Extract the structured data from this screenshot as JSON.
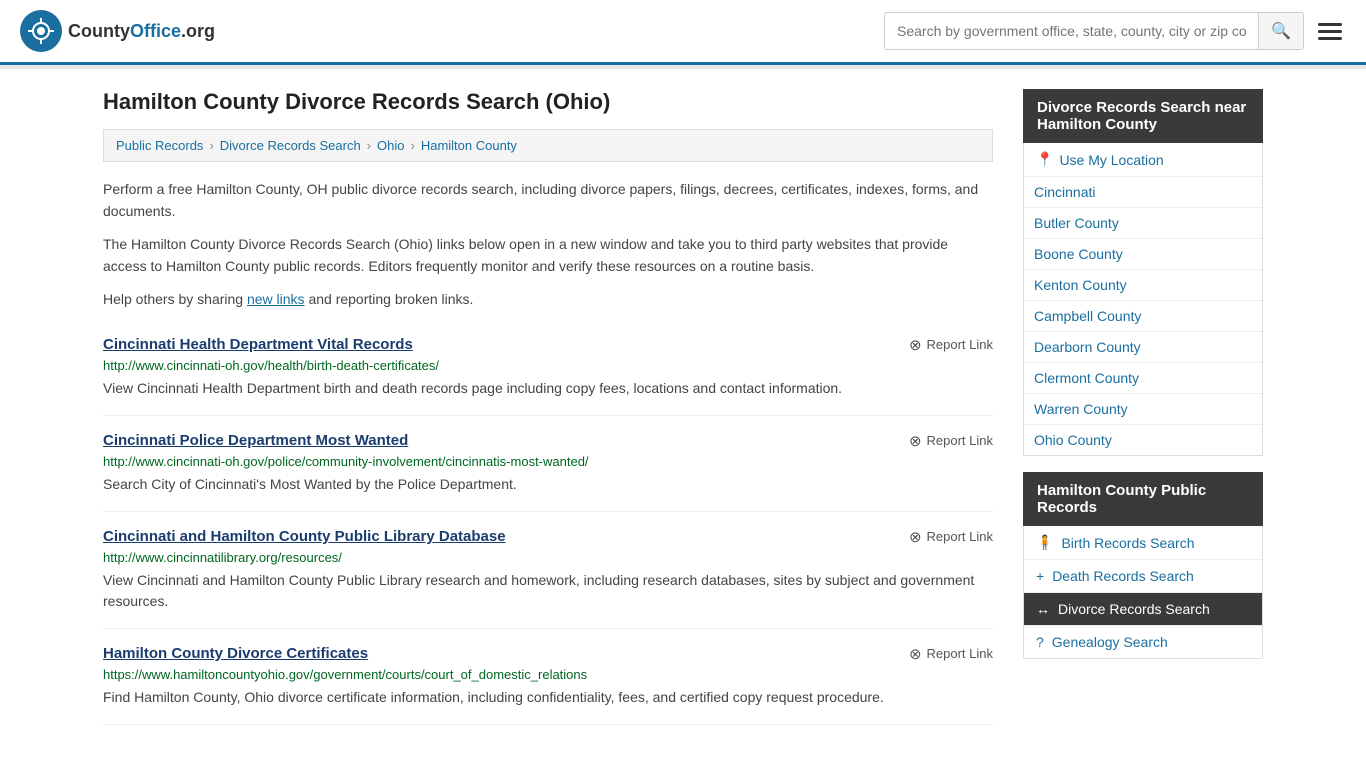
{
  "header": {
    "logo_text": "CountyOffice",
    "logo_suffix": ".org",
    "search_placeholder": "Search by government office, state, county, city or zip code",
    "search_icon": "🔍"
  },
  "page": {
    "title": "Hamilton County Divorce Records Search (Ohio)",
    "breadcrumbs": [
      {
        "label": "Public Records",
        "href": "#"
      },
      {
        "label": "Divorce Records Search",
        "href": "#"
      },
      {
        "label": "Ohio",
        "href": "#"
      },
      {
        "label": "Hamilton County",
        "href": "#"
      }
    ],
    "description1": "Perform a free Hamilton County, OH public divorce records search, including divorce papers, filings, decrees, certificates, indexes, forms, and documents.",
    "description2": "The Hamilton County Divorce Records Search (Ohio) links below open in a new window and take you to third party websites that provide access to Hamilton County public records. Editors frequently monitor and verify these resources on a routine basis.",
    "description3_pre": "Help others by sharing ",
    "description3_link": "new links",
    "description3_post": " and reporting broken links."
  },
  "records": [
    {
      "title": "Cincinnati Health Department Vital Records",
      "url": "http://www.cincinnati-oh.gov/health/birth-death-certificates/",
      "description": "View Cincinnati Health Department birth and death records page including copy fees, locations and contact information.",
      "report_label": "Report Link"
    },
    {
      "title": "Cincinnati Police Department Most Wanted",
      "url": "http://www.cincinnati-oh.gov/police/community-involvement/cincinnatis-most-wanted/",
      "description": "Search City of Cincinnati's Most Wanted by the Police Department.",
      "report_label": "Report Link"
    },
    {
      "title": "Cincinnati and Hamilton County Public Library Database",
      "url": "http://www.cincinnatilibrary.org/resources/",
      "description": "View Cincinnati and Hamilton County Public Library research and homework, including research databases, sites by subject and government resources.",
      "report_label": "Report Link"
    },
    {
      "title": "Hamilton County Divorce Certificates",
      "url": "https://www.hamiltoncountyohio.gov/government/courts/court_of_domestic_relations",
      "description": "Find Hamilton County, Ohio divorce certificate information, including confidentiality, fees, and certified copy request procedure.",
      "report_label": "Report Link"
    }
  ],
  "sidebar": {
    "nearby_title": "Divorce Records Search near Hamilton County",
    "use_location": "Use My Location",
    "nearby_items": [
      {
        "label": "Cincinnati"
      },
      {
        "label": "Butler County"
      },
      {
        "label": "Boone County"
      },
      {
        "label": "Kenton County"
      },
      {
        "label": "Campbell County"
      },
      {
        "label": "Dearborn County"
      },
      {
        "label": "Clermont County"
      },
      {
        "label": "Warren County"
      },
      {
        "label": "Ohio County"
      }
    ],
    "public_records_title": "Hamilton County Public Records",
    "public_records_items": [
      {
        "label": "Birth Records Search",
        "icon": "person",
        "active": false
      },
      {
        "label": "Death Records Search",
        "icon": "cross",
        "active": false
      },
      {
        "label": "Divorce Records Search",
        "icon": "arrows",
        "active": true
      },
      {
        "label": "Genealogy Search",
        "icon": "question",
        "active": false
      }
    ]
  }
}
